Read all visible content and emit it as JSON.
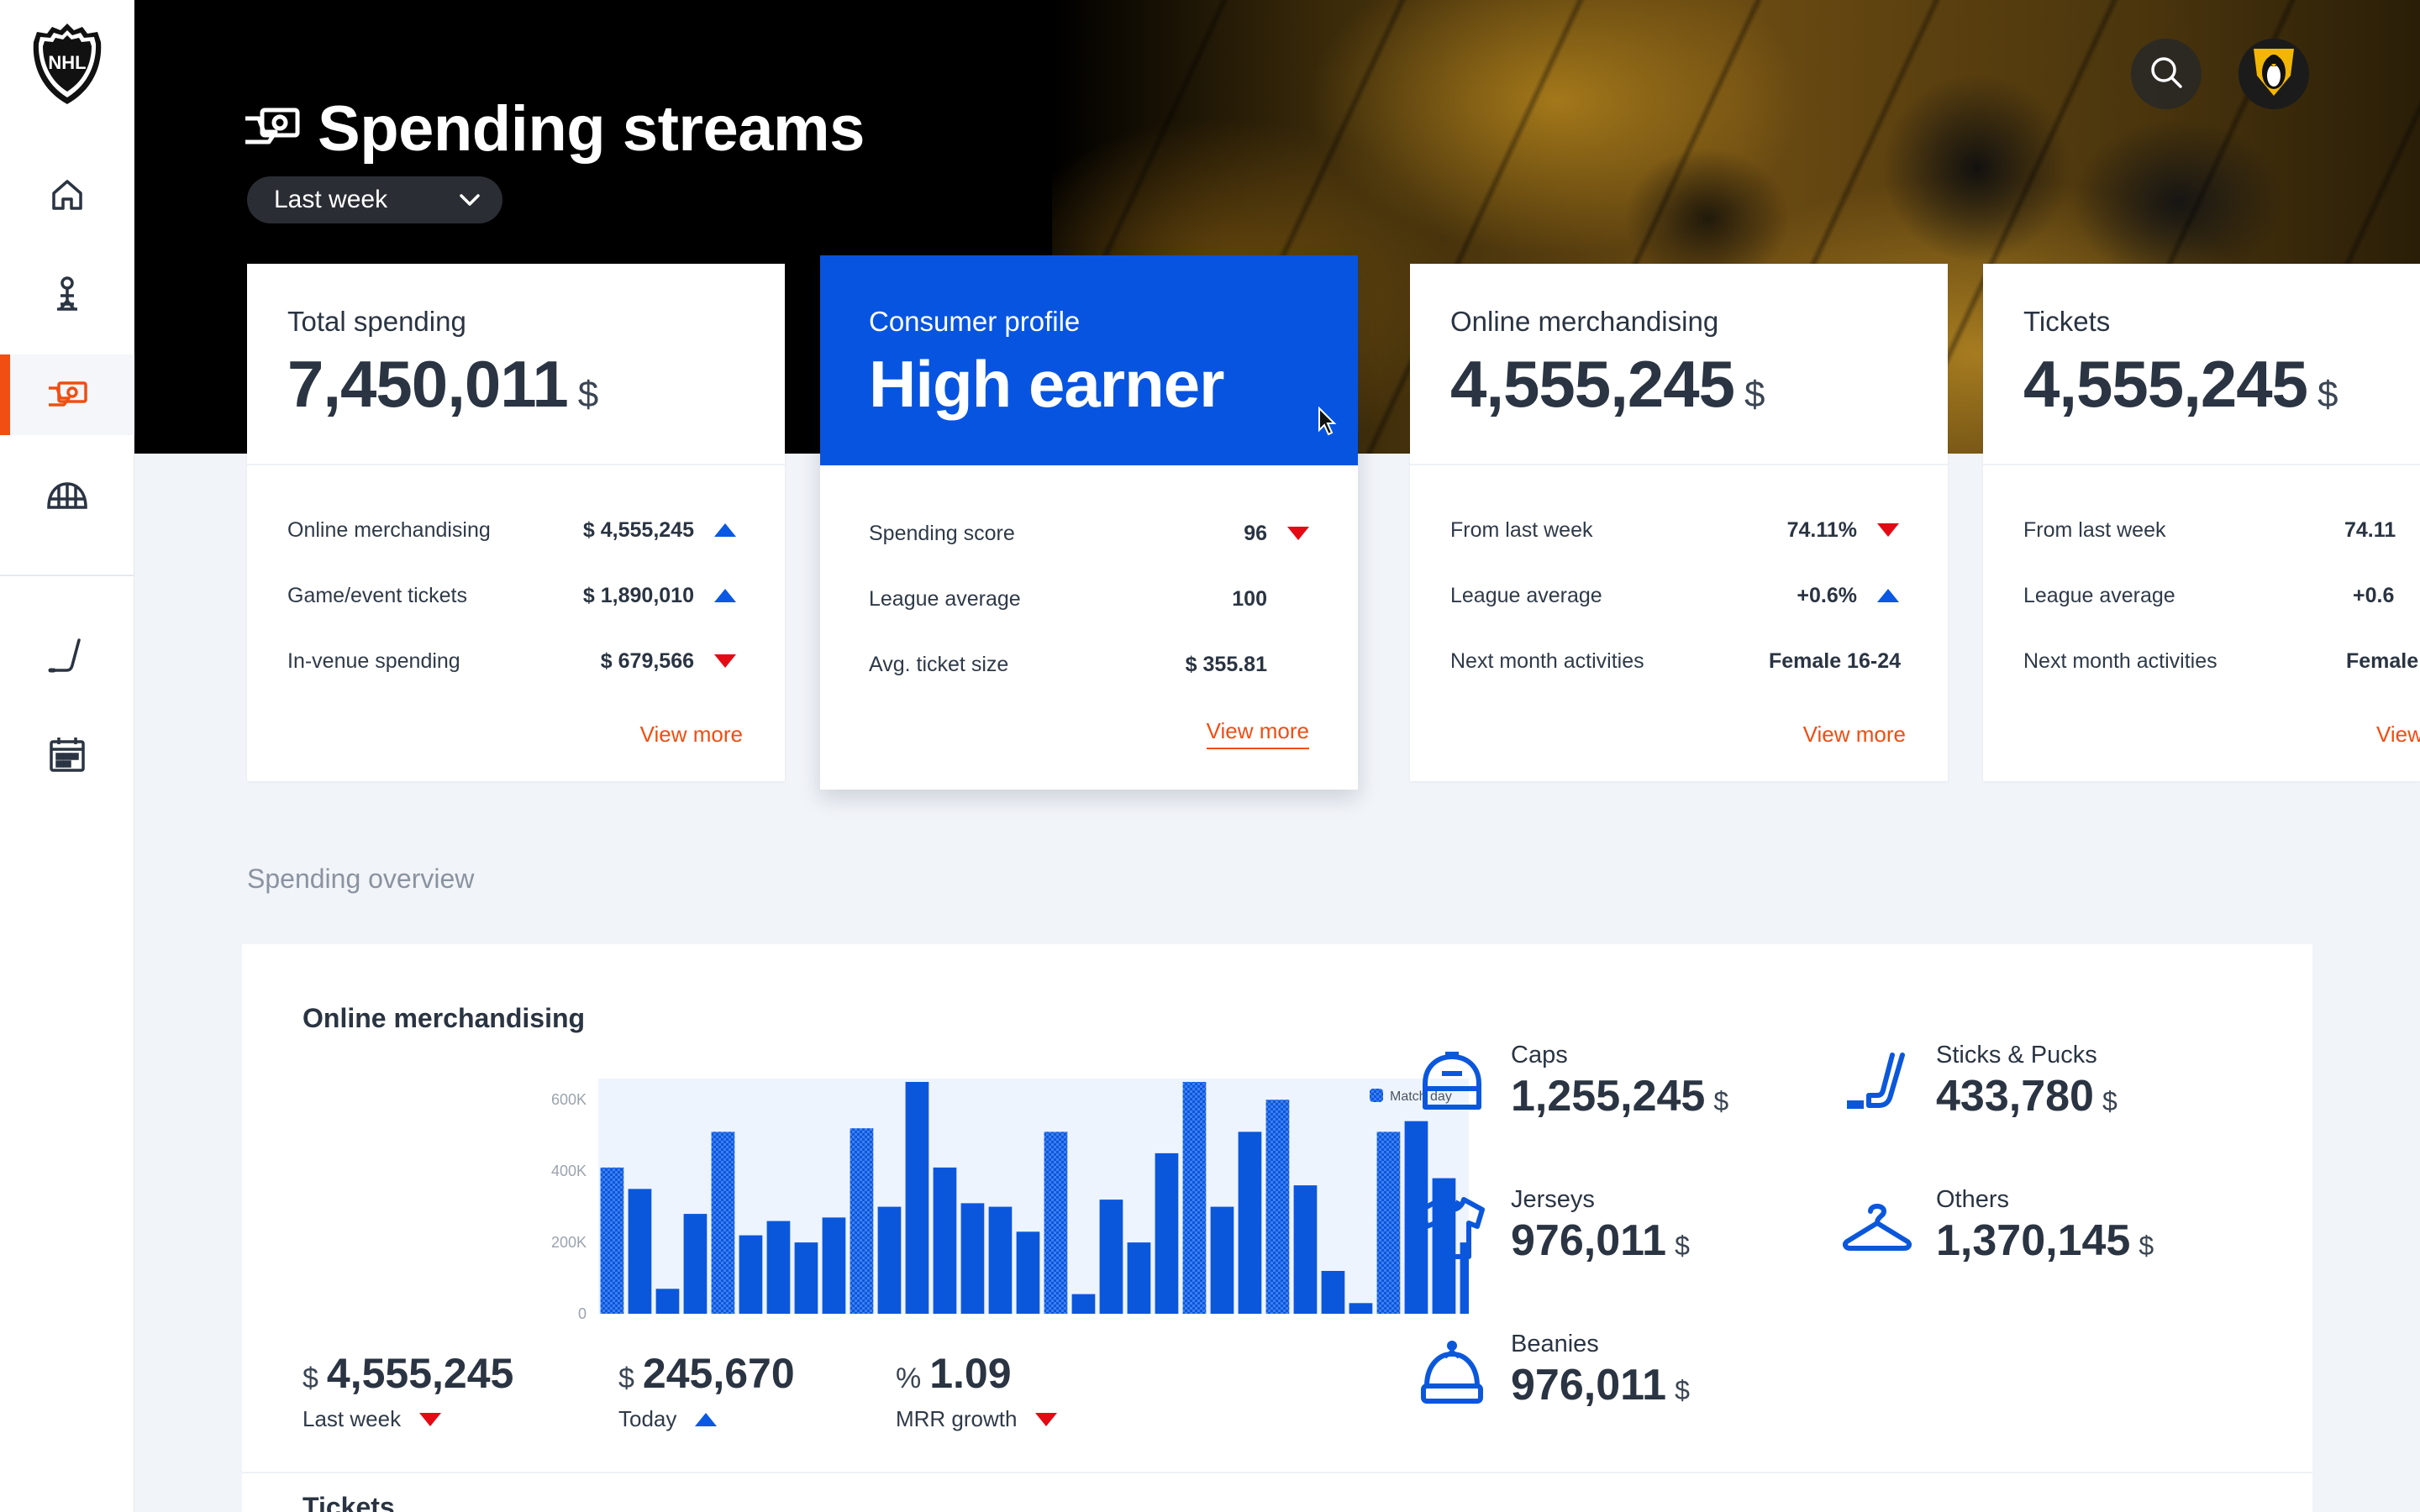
{
  "app": {
    "brand": "NHL"
  },
  "header": {
    "title": "Spending streams",
    "period": "Last week"
  },
  "sidebar": {
    "items": [
      {
        "name": "home"
      },
      {
        "name": "player"
      },
      {
        "name": "spending",
        "active": true
      },
      {
        "name": "arena"
      },
      {
        "name": "hockey-stick"
      },
      {
        "name": "calendar"
      }
    ]
  },
  "cards": [
    {
      "label": "Total spending",
      "value": "7,450,011",
      "currency": "$",
      "rows": [
        {
          "label": "Online merchandising",
          "value": "$ 4,555,245",
          "trend": "up"
        },
        {
          "label": "Game/event tickets",
          "value": "$ 1,890,010",
          "trend": "up"
        },
        {
          "label": "In-venue spending",
          "value": "$ 679,566",
          "trend": "down"
        }
      ],
      "link": "View more"
    },
    {
      "label": "Consumer profile",
      "value": "High earner",
      "currency": "",
      "rows": [
        {
          "label": "Spending score",
          "value": "96",
          "trend": "down"
        },
        {
          "label": "League average",
          "value": "100",
          "trend": ""
        },
        {
          "label": "Avg. ticket size",
          "value": "$ 355.81",
          "trend": ""
        }
      ],
      "link": "View more"
    },
    {
      "label": "Online merchandising",
      "value": "4,555,245",
      "currency": "$",
      "rows": [
        {
          "label": "From last week",
          "value": "74.11%",
          "trend": "down"
        },
        {
          "label": "League average",
          "value": "+0.6%",
          "trend": "up"
        },
        {
          "label": "Next month activities",
          "value": "Female 16-24",
          "trend": ""
        }
      ],
      "link": "View more"
    },
    {
      "label": "Tickets",
      "value": "4,555,245",
      "currency": "$",
      "rows": [
        {
          "label": "From last week",
          "value": "74.11",
          "trend": ""
        },
        {
          "label": "League average",
          "value": "+0.6",
          "trend": ""
        },
        {
          "label": "Next month activities",
          "value": "Female",
          "trend": ""
        }
      ],
      "link": "View"
    }
  ],
  "overview": {
    "section_label": "Spending overview",
    "chart_title": "Online merchandising",
    "kpis": [
      {
        "prefix": "$",
        "value": "4,555,245",
        "label": "Last week",
        "trend": "down"
      },
      {
        "prefix": "$",
        "value": "245,670",
        "label": "Today",
        "trend": "up"
      },
      {
        "prefix": "%",
        "value": "1.09",
        "label": "MRR growth",
        "trend": "down"
      }
    ],
    "categories": [
      {
        "name": "Caps",
        "value": "1,255,245",
        "currency": "$",
        "icon": "cap-icon"
      },
      {
        "name": "Sticks & Pucks",
        "value": "433,780",
        "currency": "$",
        "icon": "stick-puck-icon"
      },
      {
        "name": "Jerseys",
        "value": "976,011",
        "currency": "$",
        "icon": "jersey-icon"
      },
      {
        "name": "Others",
        "value": "1,370,145",
        "currency": "$",
        "icon": "hanger-icon"
      },
      {
        "name": "Beanies",
        "value": "976,011",
        "currency": "$",
        "icon": "beanie-icon"
      }
    ],
    "next_section_label": "Tickets"
  },
  "colors": {
    "accent": "#f04e12",
    "primary": "#0754e0",
    "bar": "#0b57dc",
    "up": "#0a58e3",
    "down": "#e40a14"
  },
  "chart_data": {
    "type": "bar",
    "title": "Online merchandising",
    "xlabel": "",
    "ylabel": "",
    "ylim": [
      0,
      650000
    ],
    "yticks": [
      "0",
      "200K",
      "400K",
      "600K"
    ],
    "legend": {
      "entries": [
        "Match day"
      ],
      "placement": "top-right"
    },
    "values": [
      410000,
      350000,
      70000,
      280000,
      510000,
      220000,
      260000,
      200000,
      270000,
      520000,
      300000,
      650000,
      410000,
      310000,
      300000,
      230000,
      510000,
      55000,
      320000,
      200000,
      450000,
      650000,
      300000,
      510000,
      600000,
      360000,
      120000,
      30000,
      510000,
      540000,
      380000,
      200000
    ],
    "match_day": [
      true,
      false,
      false,
      false,
      true,
      false,
      false,
      false,
      false,
      true,
      false,
      false,
      false,
      false,
      false,
      false,
      true,
      false,
      false,
      false,
      false,
      true,
      false,
      false,
      true,
      false,
      false,
      false,
      true,
      false,
      false,
      false
    ]
  }
}
